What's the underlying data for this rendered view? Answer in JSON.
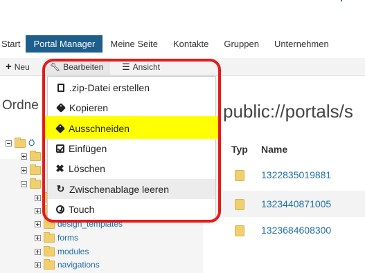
{
  "nav": {
    "items": [
      {
        "label": "Start",
        "active": false
      },
      {
        "label": "Portal Manager",
        "active": true
      },
      {
        "label": "Meine Seite",
        "active": false
      },
      {
        "label": "Kontakte",
        "active": false
      },
      {
        "label": "Gruppen",
        "active": false
      },
      {
        "label": "Unternehmen",
        "active": false
      }
    ]
  },
  "toolbar": {
    "new_label": "Neu",
    "edit_label": "Bearbeiten",
    "view_label": "Ansicht"
  },
  "section": {
    "folders_heading": "Ordne",
    "path": "public://portals/s"
  },
  "tree": {
    "root_label": "Ö",
    "items": [
      {
        "label": "design_templates"
      },
      {
        "label": "forms"
      },
      {
        "label": "modules"
      },
      {
        "label": "navigations"
      }
    ]
  },
  "table": {
    "headers": {
      "type": "Typ",
      "name": "Name"
    },
    "rows": [
      {
        "name": "1322835019881"
      },
      {
        "name": "1323440871005"
      },
      {
        "name": "1323684608300"
      }
    ]
  },
  "menu": {
    "items": [
      {
        "label": ".zip-Datei erstellen",
        "icon": "file-icon"
      },
      {
        "label": "Kopieren",
        "icon": "tag-icon"
      },
      {
        "label": "Ausschneiden",
        "icon": "tag-icon",
        "highlighted": true
      },
      {
        "label": "Einfügen",
        "icon": "check-icon"
      },
      {
        "label": "Löschen",
        "icon": "close-icon"
      },
      {
        "label": "Zwischenablage leeren",
        "icon": "refresh-icon",
        "hover": true
      },
      {
        "label": "Touch",
        "icon": "clock-icon"
      }
    ]
  },
  "colors": {
    "nav_active": "#1d5e8d",
    "link": "#1f6fa8",
    "highlight": "#ffff00",
    "annotation": "#e51a1a"
  }
}
